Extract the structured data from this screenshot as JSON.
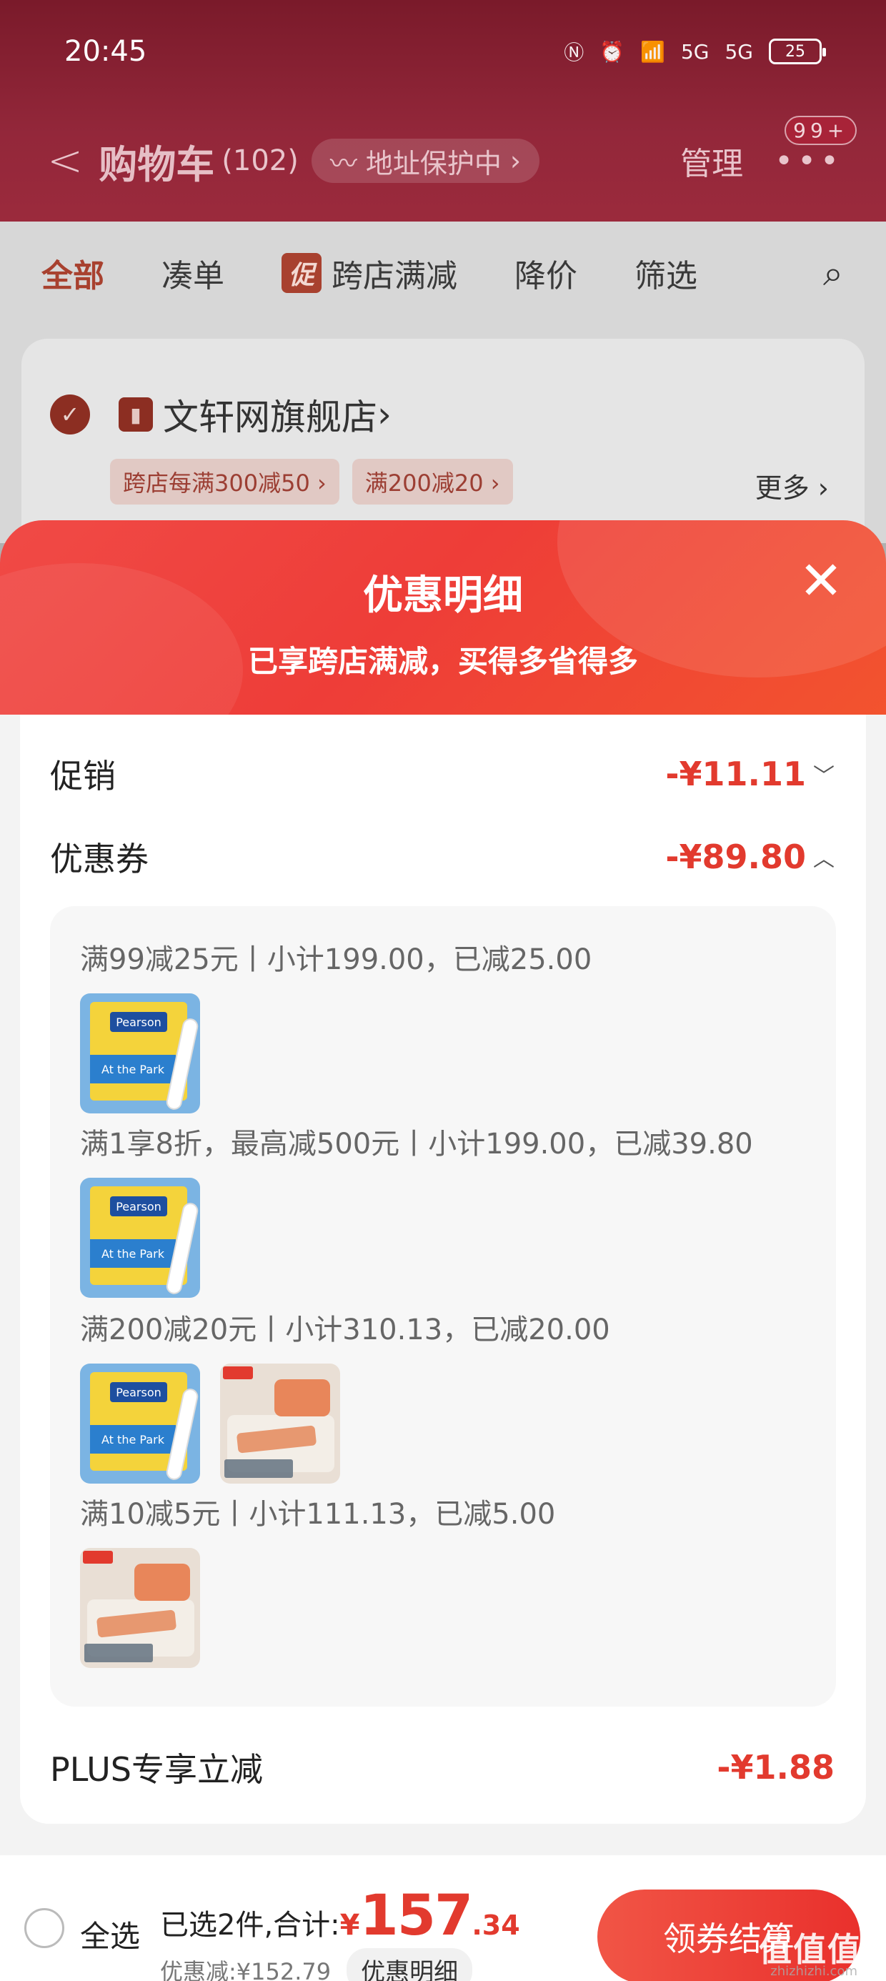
{
  "status_bar": {
    "time": "20:45",
    "net1": "5G",
    "net2": "5G",
    "battery": "25"
  },
  "header": {
    "back": "<",
    "title": "购物车",
    "count": "(102)",
    "address_pill": "地址保护中",
    "manage": "管理",
    "more": "•••",
    "badge": "99+"
  },
  "filters": [
    {
      "label": "全部",
      "active": true
    },
    {
      "label": "凑单"
    },
    {
      "tag": "促",
      "label": "跨店满减"
    },
    {
      "label": "降价"
    },
    {
      "label": "筛选"
    }
  ],
  "store": {
    "name": "文轩网旗舰店",
    "chips": [
      "跨店每满300减50 ›",
      "满200减20 ›"
    ],
    "more": "更多 ›"
  },
  "popup": {
    "title": "优惠明细",
    "subtitle": "已享跨店满减，买得多省得多",
    "rows": {
      "promotion": {
        "label": "促销",
        "value": "-¥11.11"
      },
      "coupon": {
        "label": "优惠券",
        "value": "-¥89.80"
      },
      "plus": {
        "label": "PLUS专享立减",
        "value": "-¥1.88"
      }
    },
    "coupons": [
      {
        "title": "满99减25元丨小计199.00，已减25.00",
        "items": [
          "book"
        ]
      },
      {
        "title": "满1享8折，最高减500元丨小计199.00，已减39.80",
        "items": [
          "book"
        ]
      },
      {
        "title": "满200减20元丨小计310.13，已减20.00",
        "items": [
          "book",
          "bedding"
        ]
      },
      {
        "title": "满10减5元丨小计111.13，已减5.00",
        "items": [
          "bedding"
        ]
      }
    ]
  },
  "footer": {
    "select_all": "全选",
    "selected_text": "已选2件,合计:",
    "currency": "¥",
    "total_int": "157",
    "total_dec": ".34",
    "discount_text": "优惠减:¥152.79",
    "detail_button": "优惠明细",
    "checkout": "领券结算"
  },
  "watermark": {
    "main": "值值值",
    "sub": "zhizhizhi.com"
  }
}
